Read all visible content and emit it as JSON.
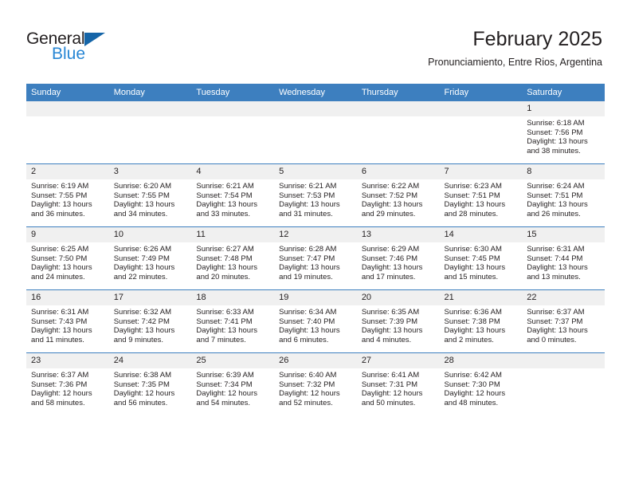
{
  "logo": {
    "word_top": "General",
    "word_bottom": "Blue",
    "triangle_color": "#1565a8",
    "blue_color": "#2786d4"
  },
  "header": {
    "title": "February 2025",
    "subtitle": "Pronunciamiento, Entre Rios, Argentina",
    "accent_color": "#3d7fbf"
  },
  "weekday_headers": [
    "Sunday",
    "Monday",
    "Tuesday",
    "Wednesday",
    "Thursday",
    "Friday",
    "Saturday"
  ],
  "weeks": [
    [
      {
        "day": "",
        "sunrise": "",
        "sunset": "",
        "daylight_line1": "",
        "daylight_line2": ""
      },
      {
        "day": "",
        "sunrise": "",
        "sunset": "",
        "daylight_line1": "",
        "daylight_line2": ""
      },
      {
        "day": "",
        "sunrise": "",
        "sunset": "",
        "daylight_line1": "",
        "daylight_line2": ""
      },
      {
        "day": "",
        "sunrise": "",
        "sunset": "",
        "daylight_line1": "",
        "daylight_line2": ""
      },
      {
        "day": "",
        "sunrise": "",
        "sunset": "",
        "daylight_line1": "",
        "daylight_line2": ""
      },
      {
        "day": "",
        "sunrise": "",
        "sunset": "",
        "daylight_line1": "",
        "daylight_line2": ""
      },
      {
        "day": "1",
        "sunrise": "Sunrise: 6:18 AM",
        "sunset": "Sunset: 7:56 PM",
        "daylight_line1": "Daylight: 13 hours",
        "daylight_line2": "and 38 minutes."
      }
    ],
    [
      {
        "day": "2",
        "sunrise": "Sunrise: 6:19 AM",
        "sunset": "Sunset: 7:55 PM",
        "daylight_line1": "Daylight: 13 hours",
        "daylight_line2": "and 36 minutes."
      },
      {
        "day": "3",
        "sunrise": "Sunrise: 6:20 AM",
        "sunset": "Sunset: 7:55 PM",
        "daylight_line1": "Daylight: 13 hours",
        "daylight_line2": "and 34 minutes."
      },
      {
        "day": "4",
        "sunrise": "Sunrise: 6:21 AM",
        "sunset": "Sunset: 7:54 PM",
        "daylight_line1": "Daylight: 13 hours",
        "daylight_line2": "and 33 minutes."
      },
      {
        "day": "5",
        "sunrise": "Sunrise: 6:21 AM",
        "sunset": "Sunset: 7:53 PM",
        "daylight_line1": "Daylight: 13 hours",
        "daylight_line2": "and 31 minutes."
      },
      {
        "day": "6",
        "sunrise": "Sunrise: 6:22 AM",
        "sunset": "Sunset: 7:52 PM",
        "daylight_line1": "Daylight: 13 hours",
        "daylight_line2": "and 29 minutes."
      },
      {
        "day": "7",
        "sunrise": "Sunrise: 6:23 AM",
        "sunset": "Sunset: 7:51 PM",
        "daylight_line1": "Daylight: 13 hours",
        "daylight_line2": "and 28 minutes."
      },
      {
        "day": "8",
        "sunrise": "Sunrise: 6:24 AM",
        "sunset": "Sunset: 7:51 PM",
        "daylight_line1": "Daylight: 13 hours",
        "daylight_line2": "and 26 minutes."
      }
    ],
    [
      {
        "day": "9",
        "sunrise": "Sunrise: 6:25 AM",
        "sunset": "Sunset: 7:50 PM",
        "daylight_line1": "Daylight: 13 hours",
        "daylight_line2": "and 24 minutes."
      },
      {
        "day": "10",
        "sunrise": "Sunrise: 6:26 AM",
        "sunset": "Sunset: 7:49 PM",
        "daylight_line1": "Daylight: 13 hours",
        "daylight_line2": "and 22 minutes."
      },
      {
        "day": "11",
        "sunrise": "Sunrise: 6:27 AM",
        "sunset": "Sunset: 7:48 PM",
        "daylight_line1": "Daylight: 13 hours",
        "daylight_line2": "and 20 minutes."
      },
      {
        "day": "12",
        "sunrise": "Sunrise: 6:28 AM",
        "sunset": "Sunset: 7:47 PM",
        "daylight_line1": "Daylight: 13 hours",
        "daylight_line2": "and 19 minutes."
      },
      {
        "day": "13",
        "sunrise": "Sunrise: 6:29 AM",
        "sunset": "Sunset: 7:46 PM",
        "daylight_line1": "Daylight: 13 hours",
        "daylight_line2": "and 17 minutes."
      },
      {
        "day": "14",
        "sunrise": "Sunrise: 6:30 AM",
        "sunset": "Sunset: 7:45 PM",
        "daylight_line1": "Daylight: 13 hours",
        "daylight_line2": "and 15 minutes."
      },
      {
        "day": "15",
        "sunrise": "Sunrise: 6:31 AM",
        "sunset": "Sunset: 7:44 PM",
        "daylight_line1": "Daylight: 13 hours",
        "daylight_line2": "and 13 minutes."
      }
    ],
    [
      {
        "day": "16",
        "sunrise": "Sunrise: 6:31 AM",
        "sunset": "Sunset: 7:43 PM",
        "daylight_line1": "Daylight: 13 hours",
        "daylight_line2": "and 11 minutes."
      },
      {
        "day": "17",
        "sunrise": "Sunrise: 6:32 AM",
        "sunset": "Sunset: 7:42 PM",
        "daylight_line1": "Daylight: 13 hours",
        "daylight_line2": "and 9 minutes."
      },
      {
        "day": "18",
        "sunrise": "Sunrise: 6:33 AM",
        "sunset": "Sunset: 7:41 PM",
        "daylight_line1": "Daylight: 13 hours",
        "daylight_line2": "and 7 minutes."
      },
      {
        "day": "19",
        "sunrise": "Sunrise: 6:34 AM",
        "sunset": "Sunset: 7:40 PM",
        "daylight_line1": "Daylight: 13 hours",
        "daylight_line2": "and 6 minutes."
      },
      {
        "day": "20",
        "sunrise": "Sunrise: 6:35 AM",
        "sunset": "Sunset: 7:39 PM",
        "daylight_line1": "Daylight: 13 hours",
        "daylight_line2": "and 4 minutes."
      },
      {
        "day": "21",
        "sunrise": "Sunrise: 6:36 AM",
        "sunset": "Sunset: 7:38 PM",
        "daylight_line1": "Daylight: 13 hours",
        "daylight_line2": "and 2 minutes."
      },
      {
        "day": "22",
        "sunrise": "Sunrise: 6:37 AM",
        "sunset": "Sunset: 7:37 PM",
        "daylight_line1": "Daylight: 13 hours",
        "daylight_line2": "and 0 minutes."
      }
    ],
    [
      {
        "day": "23",
        "sunrise": "Sunrise: 6:37 AM",
        "sunset": "Sunset: 7:36 PM",
        "daylight_line1": "Daylight: 12 hours",
        "daylight_line2": "and 58 minutes."
      },
      {
        "day": "24",
        "sunrise": "Sunrise: 6:38 AM",
        "sunset": "Sunset: 7:35 PM",
        "daylight_line1": "Daylight: 12 hours",
        "daylight_line2": "and 56 minutes."
      },
      {
        "day": "25",
        "sunrise": "Sunrise: 6:39 AM",
        "sunset": "Sunset: 7:34 PM",
        "daylight_line1": "Daylight: 12 hours",
        "daylight_line2": "and 54 minutes."
      },
      {
        "day": "26",
        "sunrise": "Sunrise: 6:40 AM",
        "sunset": "Sunset: 7:32 PM",
        "daylight_line1": "Daylight: 12 hours",
        "daylight_line2": "and 52 minutes."
      },
      {
        "day": "27",
        "sunrise": "Sunrise: 6:41 AM",
        "sunset": "Sunset: 7:31 PM",
        "daylight_line1": "Daylight: 12 hours",
        "daylight_line2": "and 50 minutes."
      },
      {
        "day": "28",
        "sunrise": "Sunrise: 6:42 AM",
        "sunset": "Sunset: 7:30 PM",
        "daylight_line1": "Daylight: 12 hours",
        "daylight_line2": "and 48 minutes."
      },
      {
        "day": "",
        "sunrise": "",
        "sunset": "",
        "daylight_line1": "",
        "daylight_line2": ""
      }
    ]
  ]
}
